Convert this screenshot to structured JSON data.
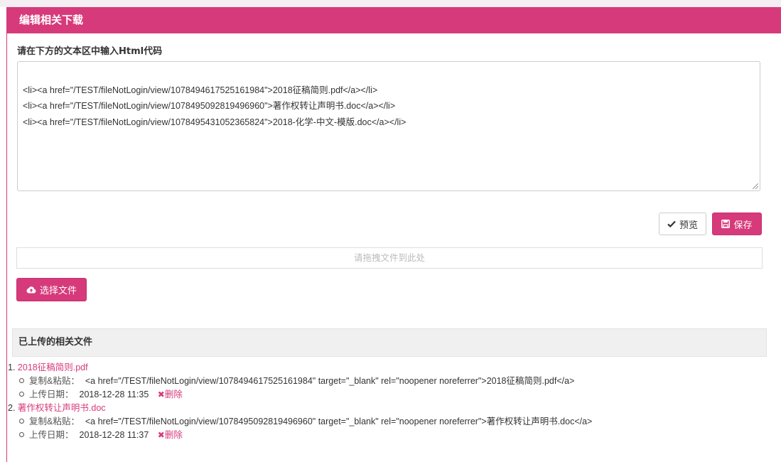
{
  "panel": {
    "title": "编辑相关下载"
  },
  "editor": {
    "label": "请在下方的文本区中输入Html代码",
    "lines": [
      "<li><a href=\"/TEST/fileNotLogin/view/1078494617525161984\">2018征稿简则.pdf</a></li>",
      "<li><a href=\"/TEST/fileNotLogin/view/1078495092819496960\">著作权转让声明书.doc</a></li>",
      "<li><a href=\"/TEST/fileNotLogin/view/1078495431052365824\">2018-化学-中文-模版.doc</a></li>"
    ]
  },
  "buttons": {
    "preview_label": "预览",
    "save_label": "保存",
    "choose_label": "选择文件"
  },
  "icons": {
    "preview": "check-icon",
    "save": "floppy-disk-icon",
    "choose": "cloud-upload-icon",
    "delete": "close-x-icon"
  },
  "dropzone": {
    "text": "请拖拽文件到此处"
  },
  "uploaded": {
    "title": "已上传的相关文件",
    "copy_label": "复制&粘贴：",
    "date_label": "上传日期：",
    "delete_label": "删除",
    "files": [
      {
        "num": "1.",
        "name": "2018征稿简则.pdf",
        "code": "<a href=\"/TEST/fileNotLogin/view/1078494617525161984\" target=\"_blank\" rel=\"noopener noreferrer\">2018征稿简则.pdf</a>",
        "date": "2018-12-28 11:35"
      },
      {
        "num": "2.",
        "name": "著作权转让声明书.doc",
        "code": "<a href=\"/TEST/fileNotLogin/view/1078495092819496960\" target=\"_blank\" rel=\"noopener noreferrer\">著作权转让声明书.doc</a>",
        "date": "2018-12-28 11:37"
      }
    ]
  },
  "colors": {
    "accent": "#d63a7a",
    "header_bg": "#f0f0f0"
  }
}
